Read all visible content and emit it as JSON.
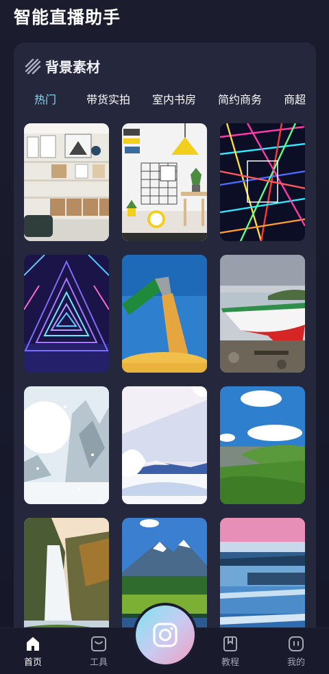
{
  "header": {
    "app_title": "智能直播助手"
  },
  "panel": {
    "title": "背景素材",
    "tabs": [
      {
        "label": "热门",
        "active": true
      },
      {
        "label": "带货实拍",
        "active": false
      },
      {
        "label": "室内书房",
        "active": false
      },
      {
        "label": "简约商务",
        "active": false
      },
      {
        "label": "商超",
        "active": false
      }
    ],
    "thumbnails": [
      "shelf-room-image",
      "yellow-lamp-room-image",
      "neon-light-tunnel-image",
      "neon-triangle-tunnel-image",
      "grain-harvester-image",
      "boat-on-shore-image",
      "snowy-forest-image",
      "snow-landscape-image",
      "green-coast-image",
      "waterfall-cliff-image",
      "mountain-lake-image",
      "cascade-sunset-image"
    ]
  },
  "navbar": {
    "items": [
      {
        "label": "首页",
        "icon": "home-icon",
        "active": true
      },
      {
        "label": "工具",
        "icon": "toolbox-icon",
        "active": false
      },
      {
        "label": "教程",
        "icon": "bookmark-book-icon",
        "active": false
      },
      {
        "label": "我的",
        "icon": "profile-face-icon",
        "active": false
      }
    ],
    "center_button_icon": "camera-icon"
  },
  "colors": {
    "accent_tab": "#8fd9f0",
    "panel_bg": "#25273d",
    "page_bg": "#1b1d2e"
  }
}
